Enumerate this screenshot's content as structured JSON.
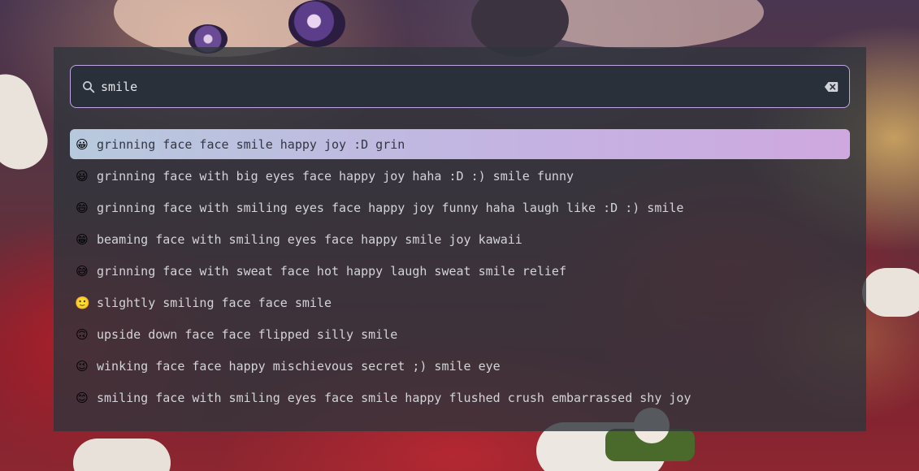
{
  "search": {
    "value": "smile",
    "placeholder": ""
  },
  "icons": {
    "search": "search-icon",
    "clear": "backspace-clear-icon"
  },
  "colors": {
    "accent_border": "#c2a6e4",
    "selected_gradient_start": "#b7c9dd",
    "selected_gradient_end": "#cfa8e0",
    "panel_background": "#30343c",
    "text": "#d2d4d8"
  },
  "results": [
    {
      "emoji": "😀",
      "text": "grinning face face smile happy joy :D grin",
      "selected": true
    },
    {
      "emoji": "😃",
      "text": "grinning face with big eyes face happy joy haha :D :) smile funny",
      "selected": false
    },
    {
      "emoji": "😄",
      "text": "grinning face with smiling eyes face happy joy funny haha laugh like :D :) smile",
      "selected": false
    },
    {
      "emoji": "😁",
      "text": "beaming face with smiling eyes face happy smile joy kawaii",
      "selected": false
    },
    {
      "emoji": "😅",
      "text": "grinning face with sweat face hot happy laugh sweat smile relief",
      "selected": false
    },
    {
      "emoji": "🙂",
      "text": "slightly smiling face face smile",
      "selected": false
    },
    {
      "emoji": "🙃",
      "text": "upside down face face flipped silly smile",
      "selected": false
    },
    {
      "emoji": "😉",
      "text": "winking face face happy mischievous secret ;) smile eye",
      "selected": false
    },
    {
      "emoji": "😊",
      "text": "smiling face with smiling eyes face smile happy flushed crush embarrassed shy joy",
      "selected": false
    }
  ]
}
